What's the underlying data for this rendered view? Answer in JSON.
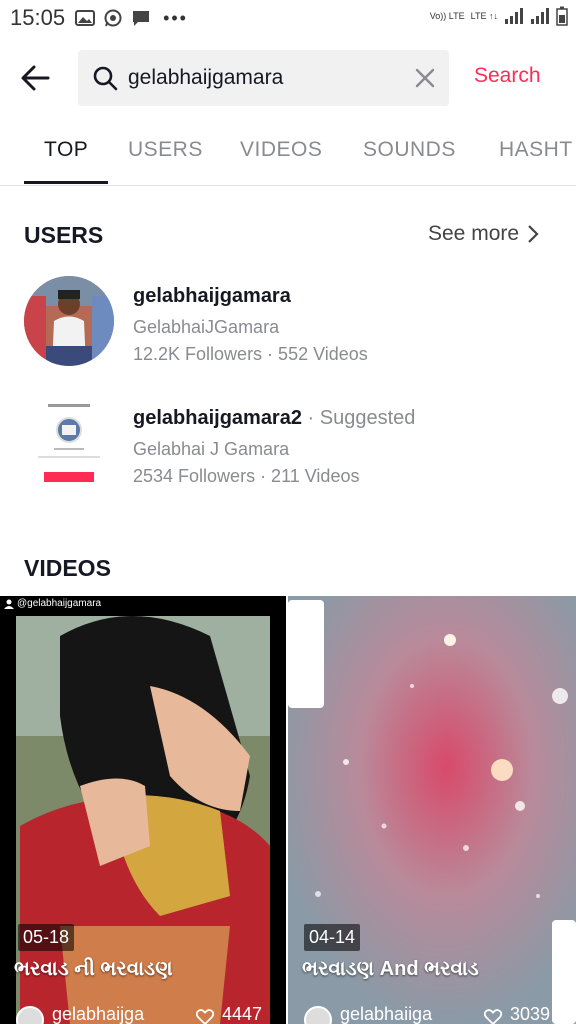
{
  "status_bar": {
    "time": "15:05",
    "lte1": "Vo)) LTE",
    "lte2": "LTE ↑↓"
  },
  "search": {
    "query": "gelabhaijgamara",
    "button_label": "Search"
  },
  "tabs": [
    {
      "label": "TOP"
    },
    {
      "label": "USERS"
    },
    {
      "label": "VIDEOS"
    },
    {
      "label": "SOUNDS"
    },
    {
      "label": "HASHT"
    }
  ],
  "users_section": {
    "title": "USERS",
    "see_more": "See more",
    "users": [
      {
        "name": "gelabhaijgamara",
        "suggested": "",
        "handle": "GelabhaiJGamara",
        "stats": "12.2K Followers · 552 Videos"
      },
      {
        "name": "gelabhaijgamara2",
        "suggested": " · Suggested",
        "handle": "Gelabhai J Gamara",
        "stats": "2534 Followers · 211 Videos"
      }
    ]
  },
  "videos_section": {
    "title": "VIDEOS",
    "videos": [
      {
        "watermark": "@gelabhaijgamara",
        "date": "05-18",
        "caption": "ભરવાડ ની ભરવાડણ",
        "author": "gelabhaijga",
        "likes": "4447"
      },
      {
        "watermark": "",
        "date": "04-14",
        "caption": "ભરવાડણ And ભરવાડ",
        "author": "gelabhaiiga",
        "likes": "3039"
      }
    ]
  },
  "colors": {
    "accent": "#fe2c55",
    "text": "#161823",
    "muted": "#8a8b91"
  }
}
